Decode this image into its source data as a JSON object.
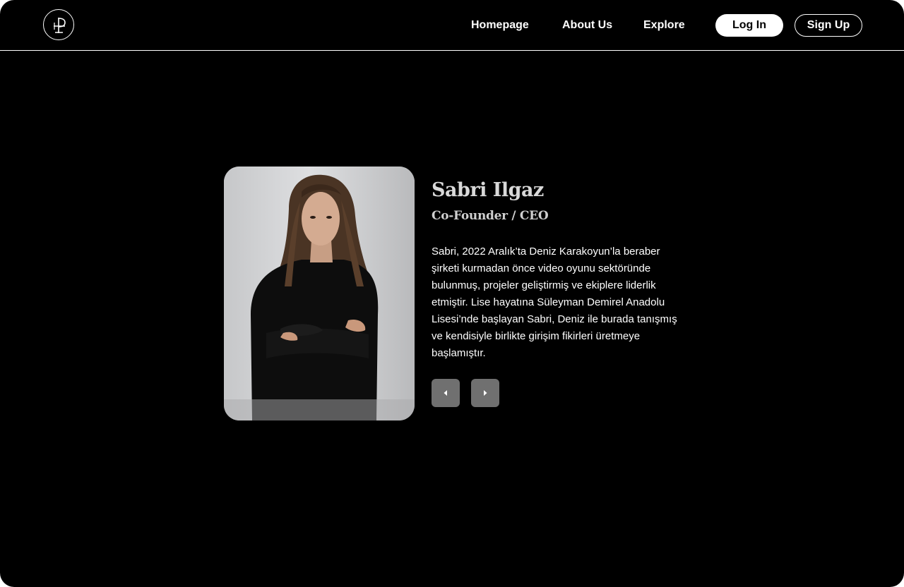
{
  "nav": {
    "logo": "logo-icon",
    "links": [
      "Homepage",
      "About Us",
      "Explore"
    ],
    "login_label": "Log In",
    "signup_label": "Sign Up"
  },
  "profile": {
    "name": "Sabri Ilgaz",
    "role": "Co-Founder / CEO",
    "bio": "Sabri, 2022 Aralık’ta Deniz Karakoyun’la beraber şirketi kurmadan önce video oyunu sektöründe bulunmuş, projeler geliştirmiş ve ekiplere liderlik etmiştir. Lise hayatına Süleyman Demirel Anadolu Lisesi’nde başlayan Sabri, Deniz ile burada tanışmış ve kendisiyle birlikte girişim fikirleri üretmeye başlamıştır.",
    "photo": "portrait-photo"
  },
  "controls": {
    "prev_icon": "caret-left-icon",
    "next_icon": "caret-right-icon"
  },
  "colors": {
    "background": "#000000",
    "text": "#ffffff",
    "arrow_button": "#707070"
  }
}
